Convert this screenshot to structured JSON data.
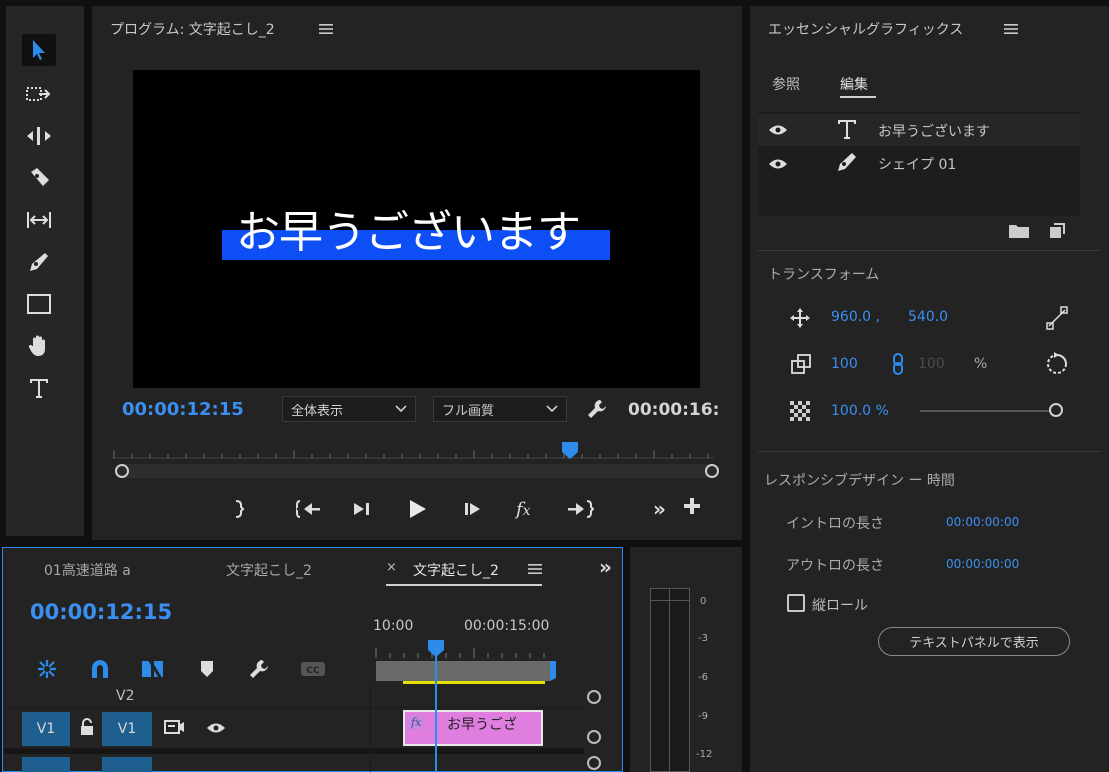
{
  "colors": {
    "accent": "#2d8ceb",
    "selection_bar": "#0d4ef5",
    "clip_pink": "#e07ee0",
    "track_blue": "#1f5f8f",
    "yellow": "#e8e000"
  },
  "program": {
    "title": "プログラム: 文字起こし_2",
    "menu_icon": "menu-icon",
    "overlay_text": "お早うございます",
    "timecode_current": "00:00:12:15",
    "zoom_select": "全体表示",
    "quality_select": "フル画質",
    "timecode_duration": "00:00:16:"
  },
  "essential_graphics": {
    "title": "エッセンシャルグラフィックス",
    "tab_browse": "参照",
    "tab_edit": "編集",
    "layers": [
      {
        "name": "お早うございます",
        "type_icon": "text-type-icon"
      },
      {
        "name": "シェイプ 01",
        "type_icon": "pen-icon"
      }
    ],
    "transform_label": "トランスフォーム",
    "position_x": "960.0 ,",
    "position_y": "540.0",
    "scale": "100",
    "scale_width": "100",
    "percent": "%",
    "opacity": "100.0 %",
    "opacity_fraction": 1.0,
    "responsive_title": "レスポンシブデザイン ー 時間",
    "intro_label": "イントロの長さ",
    "intro_value": "00:00:00:00",
    "outro_label": "アウトロの長さ",
    "outro_value": "00:00:00:00",
    "roll_checkbox": "縦ロール",
    "show_text_panel": "テキストパネルで表示"
  },
  "timeline": {
    "tabs": [
      "01高速道路 a",
      "文字起こし_2",
      "文字起こし_2"
    ],
    "close_symbol": "×",
    "more_symbol": "»",
    "timecode": "00:00:12:15",
    "ruler_left": "10:00",
    "ruler_right": "00:00:15:00",
    "track_v2": "V2",
    "track_v1_source": "V1",
    "track_v1": "V1",
    "clip_fx": "fx",
    "clip_label": "お早うござ"
  },
  "audio_meter": {
    "scale": [
      "0",
      "-3",
      "-6",
      "-9",
      "-12"
    ]
  }
}
